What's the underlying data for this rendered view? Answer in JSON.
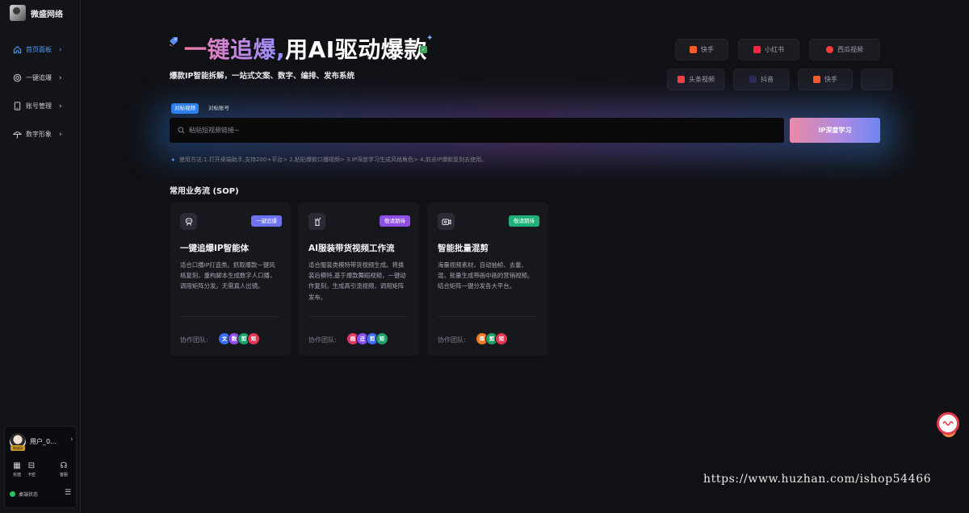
{
  "brand": {
    "name": "微盛网络"
  },
  "sidebar": {
    "items": [
      {
        "label": "首页面板",
        "icon": "home-icon",
        "active": true
      },
      {
        "label": "一键追爆",
        "icon": "target-icon",
        "active": false
      },
      {
        "label": "账号管理",
        "icon": "phone-icon",
        "active": false
      },
      {
        "label": "数字形象",
        "icon": "umbrella-icon",
        "active": false
      }
    ]
  },
  "user": {
    "name": "用户_0...",
    "badge": "微盛网",
    "quick": [
      {
        "label": "充值",
        "icon": "grid-icon"
      },
      {
        "label": "卡密",
        "icon": "gift-icon"
      },
      {
        "label": "客服",
        "icon": "headset-icon"
      }
    ],
    "status_label": "桌端状态",
    "status_color": "#22c55e"
  },
  "hero": {
    "title_gradient": "一键追爆,",
    "title_white": "用AI驱动爆款",
    "subtitle": "爆款IP智能拆解，一站式文案、数字、编排、发布系统"
  },
  "platforms": [
    {
      "label": "快手",
      "color": "#ff5a2a"
    },
    {
      "label": "小红书",
      "color": "#ff2442"
    },
    {
      "label": "西瓜视频",
      "color": "#ff3b3b"
    },
    {
      "label": "头条视频",
      "color": "#f04142"
    },
    {
      "label": "抖音",
      "color": "#2a2a55"
    },
    {
      "label": "快手",
      "color": "#ff5a2a"
    }
  ],
  "search": {
    "tabs": [
      {
        "label": "对标视频",
        "active": true
      },
      {
        "label": "对标账号",
        "active": false
      }
    ],
    "placeholder": "粘贴短视频链接~",
    "value": "",
    "button_label": "IP深度学习",
    "usage": "使用方法:1.打开桌端助手,支持200+平台> 2.粘贴爆款口播视频> 3.IP深度学习生成风格角色> 4.前去IP爆款复刻去使用。"
  },
  "sop": {
    "title": "常用业务流 (SOP)",
    "team_label": "协作团队:",
    "cards": [
      {
        "icon": "robot-icon",
        "badge": "一键追爆",
        "badge_color": "#6d73f0",
        "title": "一键追爆IP智能体",
        "desc": "适合口播IP打造类。抓取爆款—键风格复刻，重构脚本生成数字人口播，调用矩阵分发。无需真人出镜。",
        "team": [
          {
            "ch": "文",
            "color": "#3b6cf3"
          },
          {
            "ch": "数",
            "color": "#8b4df0"
          },
          {
            "ch": "剪",
            "color": "#1fa06a"
          },
          {
            "ch": "矩",
            "color": "#e0364e"
          }
        ]
      },
      {
        "icon": "hanger-icon",
        "badge": "敬请期待",
        "badge_color": "#8e4fe6",
        "title": "AI服装带货视频工作流",
        "desc": "适合服装类模特带货视频生成。将换装后模特,基于爆款舞蹈视频，一键动作复刻，生成高引流视频，调用矩阵发布。",
        "team": [
          {
            "ch": "画",
            "color": "#e23a68"
          },
          {
            "ch": "迁",
            "color": "#8b4df0"
          },
          {
            "ch": "剪",
            "color": "#3b6cf3"
          },
          {
            "ch": "矩",
            "color": "#1fa06a"
          }
        ]
      },
      {
        "icon": "video-edit-icon",
        "badge": "敬请期待",
        "badge_color": "#1fb07a",
        "title": "智能批量混剪",
        "desc": "海量视频素材，自动抽帧、去重、混，批量生成带画中画的营销视频。结合矩阵一键分发各大平台。",
        "team": [
          {
            "ch": "库",
            "color": "#f07a22"
          },
          {
            "ch": "剪",
            "color": "#1fa06a"
          },
          {
            "ch": "矩",
            "color": "#e0364e"
          }
        ]
      }
    ]
  },
  "watermark": "https://www.huzhan.com/ishop54466"
}
